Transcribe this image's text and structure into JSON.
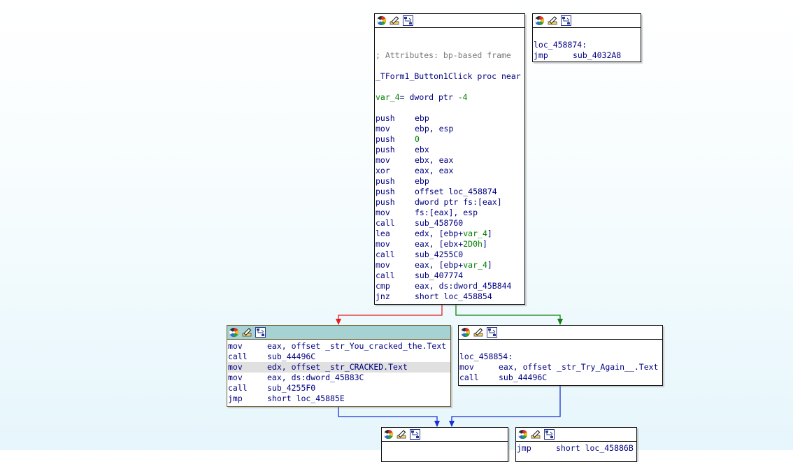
{
  "icons": [
    "color-wheel-icon",
    "rename-icon",
    "flow-graph-icon"
  ],
  "colors": {
    "edge_false": "#e02020",
    "edge_true": "#108010",
    "edge_uncond": "#1a2fd6",
    "selected_title": "#a6d2d3",
    "instruction": "#000080",
    "comment": "#7a7a7a",
    "number": "#008000"
  },
  "nodes": [
    {
      "id": "main",
      "lines": [
        [],
        [],
        [
          {
            "t": "; Attributes: bp-based frame",
            "c": "cm"
          }
        ],
        [],
        [
          {
            "t": "_TForm1_Button1Click proc near"
          }
        ],
        [],
        [
          {
            "t": "var_4",
            "c": "gr"
          },
          {
            "t": "= dword ptr "
          },
          {
            "t": "-4",
            "c": "gr"
          }
        ],
        [],
        [
          {
            "t": "push",
            "m": 1
          },
          {
            "t": "ebp"
          }
        ],
        [
          {
            "t": "mov",
            "m": 1
          },
          {
            "t": "ebp, esp"
          }
        ],
        [
          {
            "t": "push",
            "m": 1
          },
          {
            "t": "0",
            "c": "gr"
          }
        ],
        [
          {
            "t": "push",
            "m": 1
          },
          {
            "t": "ebx"
          }
        ],
        [
          {
            "t": "mov",
            "m": 1
          },
          {
            "t": "ebx, eax"
          }
        ],
        [
          {
            "t": "xor",
            "m": 1
          },
          {
            "t": "eax, eax"
          }
        ],
        [
          {
            "t": "push",
            "m": 1
          },
          {
            "t": "ebp"
          }
        ],
        [
          {
            "t": "push",
            "m": 1
          },
          {
            "t": "offset loc_458874"
          }
        ],
        [
          {
            "t": "push",
            "m": 1
          },
          {
            "t": "dword ptr fs:[eax]"
          }
        ],
        [
          {
            "t": "mov",
            "m": 1
          },
          {
            "t": "fs:[eax], esp"
          }
        ],
        [
          {
            "t": "call",
            "m": 1
          },
          {
            "t": "sub_458760"
          }
        ],
        [
          {
            "t": "lea",
            "m": 1
          },
          {
            "t": "edx, [ebp+"
          },
          {
            "t": "var_4",
            "c": "gr"
          },
          {
            "t": "]"
          }
        ],
        [
          {
            "t": "mov",
            "m": 1
          },
          {
            "t": "eax, [ebx+"
          },
          {
            "t": "2D0h",
            "c": "gr"
          },
          {
            "t": "]"
          }
        ],
        [
          {
            "t": "call",
            "m": 1
          },
          {
            "t": "sub_4255C0"
          }
        ],
        [
          {
            "t": "mov",
            "m": 1
          },
          {
            "t": "eax, [ebp+"
          },
          {
            "t": "var_4",
            "c": "gr"
          },
          {
            "t": "]"
          }
        ],
        [
          {
            "t": "call",
            "m": 1
          },
          {
            "t": "sub_407774"
          }
        ],
        [
          {
            "t": "cmp",
            "m": 1
          },
          {
            "t": "eax, ds:dword_45B844"
          }
        ],
        [
          {
            "t": "jnz",
            "m": 1
          },
          {
            "t": "short loc_458854"
          }
        ]
      ]
    },
    {
      "id": "loc-458874",
      "lines": [
        [],
        [
          {
            "t": "loc_458874:"
          }
        ],
        [
          {
            "t": "jmp",
            "m": 1
          },
          {
            "t": "sub_4032A8"
          }
        ]
      ]
    },
    {
      "id": "cracked",
      "selected": true,
      "lines": [
        [
          {
            "t": "mov",
            "m": 1
          },
          {
            "t": "eax, offset _str_You_cracked_the.Text"
          }
        ],
        [
          {
            "t": "call",
            "m": 1
          },
          {
            "t": "sub_44496C"
          }
        ],
        [
          {
            "t": "mov",
            "m": 1
          },
          {
            "t": "edx, offset _str_CRACKED.Text"
          }
        ],
        [
          {
            "t": "mov",
            "m": 1
          },
          {
            "t": "eax, ds:dword_45B83C"
          }
        ],
        [
          {
            "t": "call",
            "m": 1
          },
          {
            "t": "sub_4255F0"
          }
        ],
        [
          {
            "t": "jmp",
            "m": 1
          },
          {
            "t": "short loc_45885E"
          }
        ]
      ],
      "highlight_line": 2
    },
    {
      "id": "try-again",
      "lines": [
        [],
        [
          {
            "t": "loc_458854:"
          }
        ],
        [
          {
            "t": "mov",
            "m": 1
          },
          {
            "t": "eax, offset _str_Try_Again__.Text"
          }
        ],
        [
          {
            "t": "call",
            "m": 1
          },
          {
            "t": "sub_44496C"
          }
        ]
      ]
    },
    {
      "id": "bottom-left",
      "lines": []
    },
    {
      "id": "bottom-right",
      "lines": [
        [
          {
            "t": "jmp",
            "m": 1
          },
          {
            "t": "short loc_45886B"
          }
        ]
      ]
    }
  ]
}
